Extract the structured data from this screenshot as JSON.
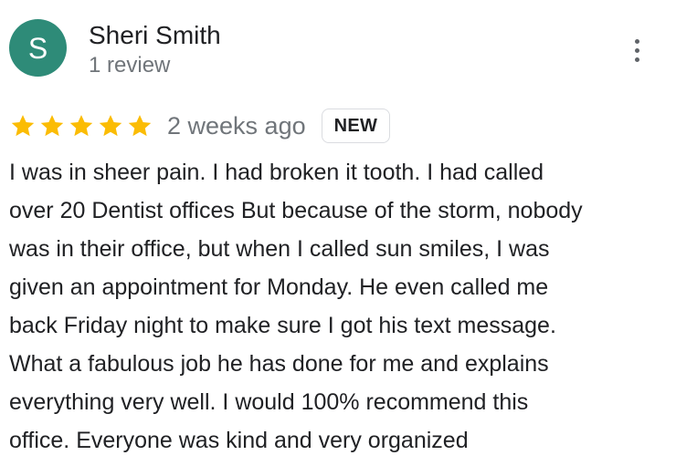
{
  "review": {
    "author": {
      "initial": "S",
      "name": "Sheri Smith",
      "review_count": "1 review",
      "avatar_color": "#2e8b78"
    },
    "rating": {
      "stars": 5,
      "max": 5,
      "star_color": "#fbbc04"
    },
    "date": "2 weeks ago",
    "badge": "NEW",
    "more_icon": "more-vert-icon",
    "text_lines": [
      "I was in sheer pain. I had broken it tooth. I had called",
      "over 20 Dentist offices But because of the storm, nobody",
      "was in their office, but when I called sun smiles, I was",
      "given an appointment for Monday. He even called me",
      "back Friday night to make sure I got his text message.",
      "What a fabulous job he has done for me and explains",
      "everything very well. I would 100% recommend this",
      "office. Everyone was kind and very organized"
    ]
  }
}
